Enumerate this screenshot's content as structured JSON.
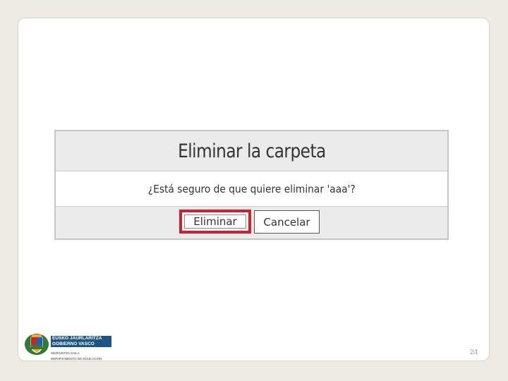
{
  "dialog": {
    "title": "Eliminar la carpeta",
    "message": "¿Está seguro de que quiere eliminar 'aaa'?",
    "delete_label": "Eliminar",
    "cancel_label": "Cancelar",
    "highlight_color": "#d0202e"
  },
  "logo": {
    "line1": "EUSKO JAURLARITZA",
    "line2": "GOBIERNO VASCO",
    "sub1": "HEZKUNTZA SAILA",
    "sub2": "DEPARTAMENTO DE EDUCACIÓN",
    "icon": "basque-government-crest-icon"
  },
  "page_number": "24"
}
